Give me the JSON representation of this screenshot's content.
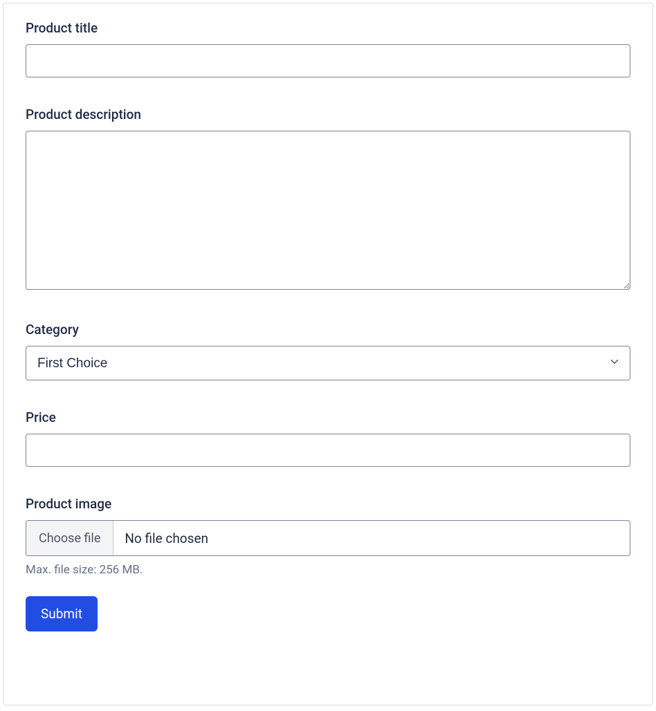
{
  "form": {
    "title": {
      "label": "Product title",
      "value": ""
    },
    "description": {
      "label": "Product description",
      "value": ""
    },
    "category": {
      "label": "Category",
      "selected": "First Choice"
    },
    "price": {
      "label": "Price",
      "value": ""
    },
    "image": {
      "label": "Product image",
      "choose_button": "Choose file",
      "status": "No file chosen",
      "hint": "Max. file size: 256 MB."
    },
    "submit_label": "Submit"
  }
}
